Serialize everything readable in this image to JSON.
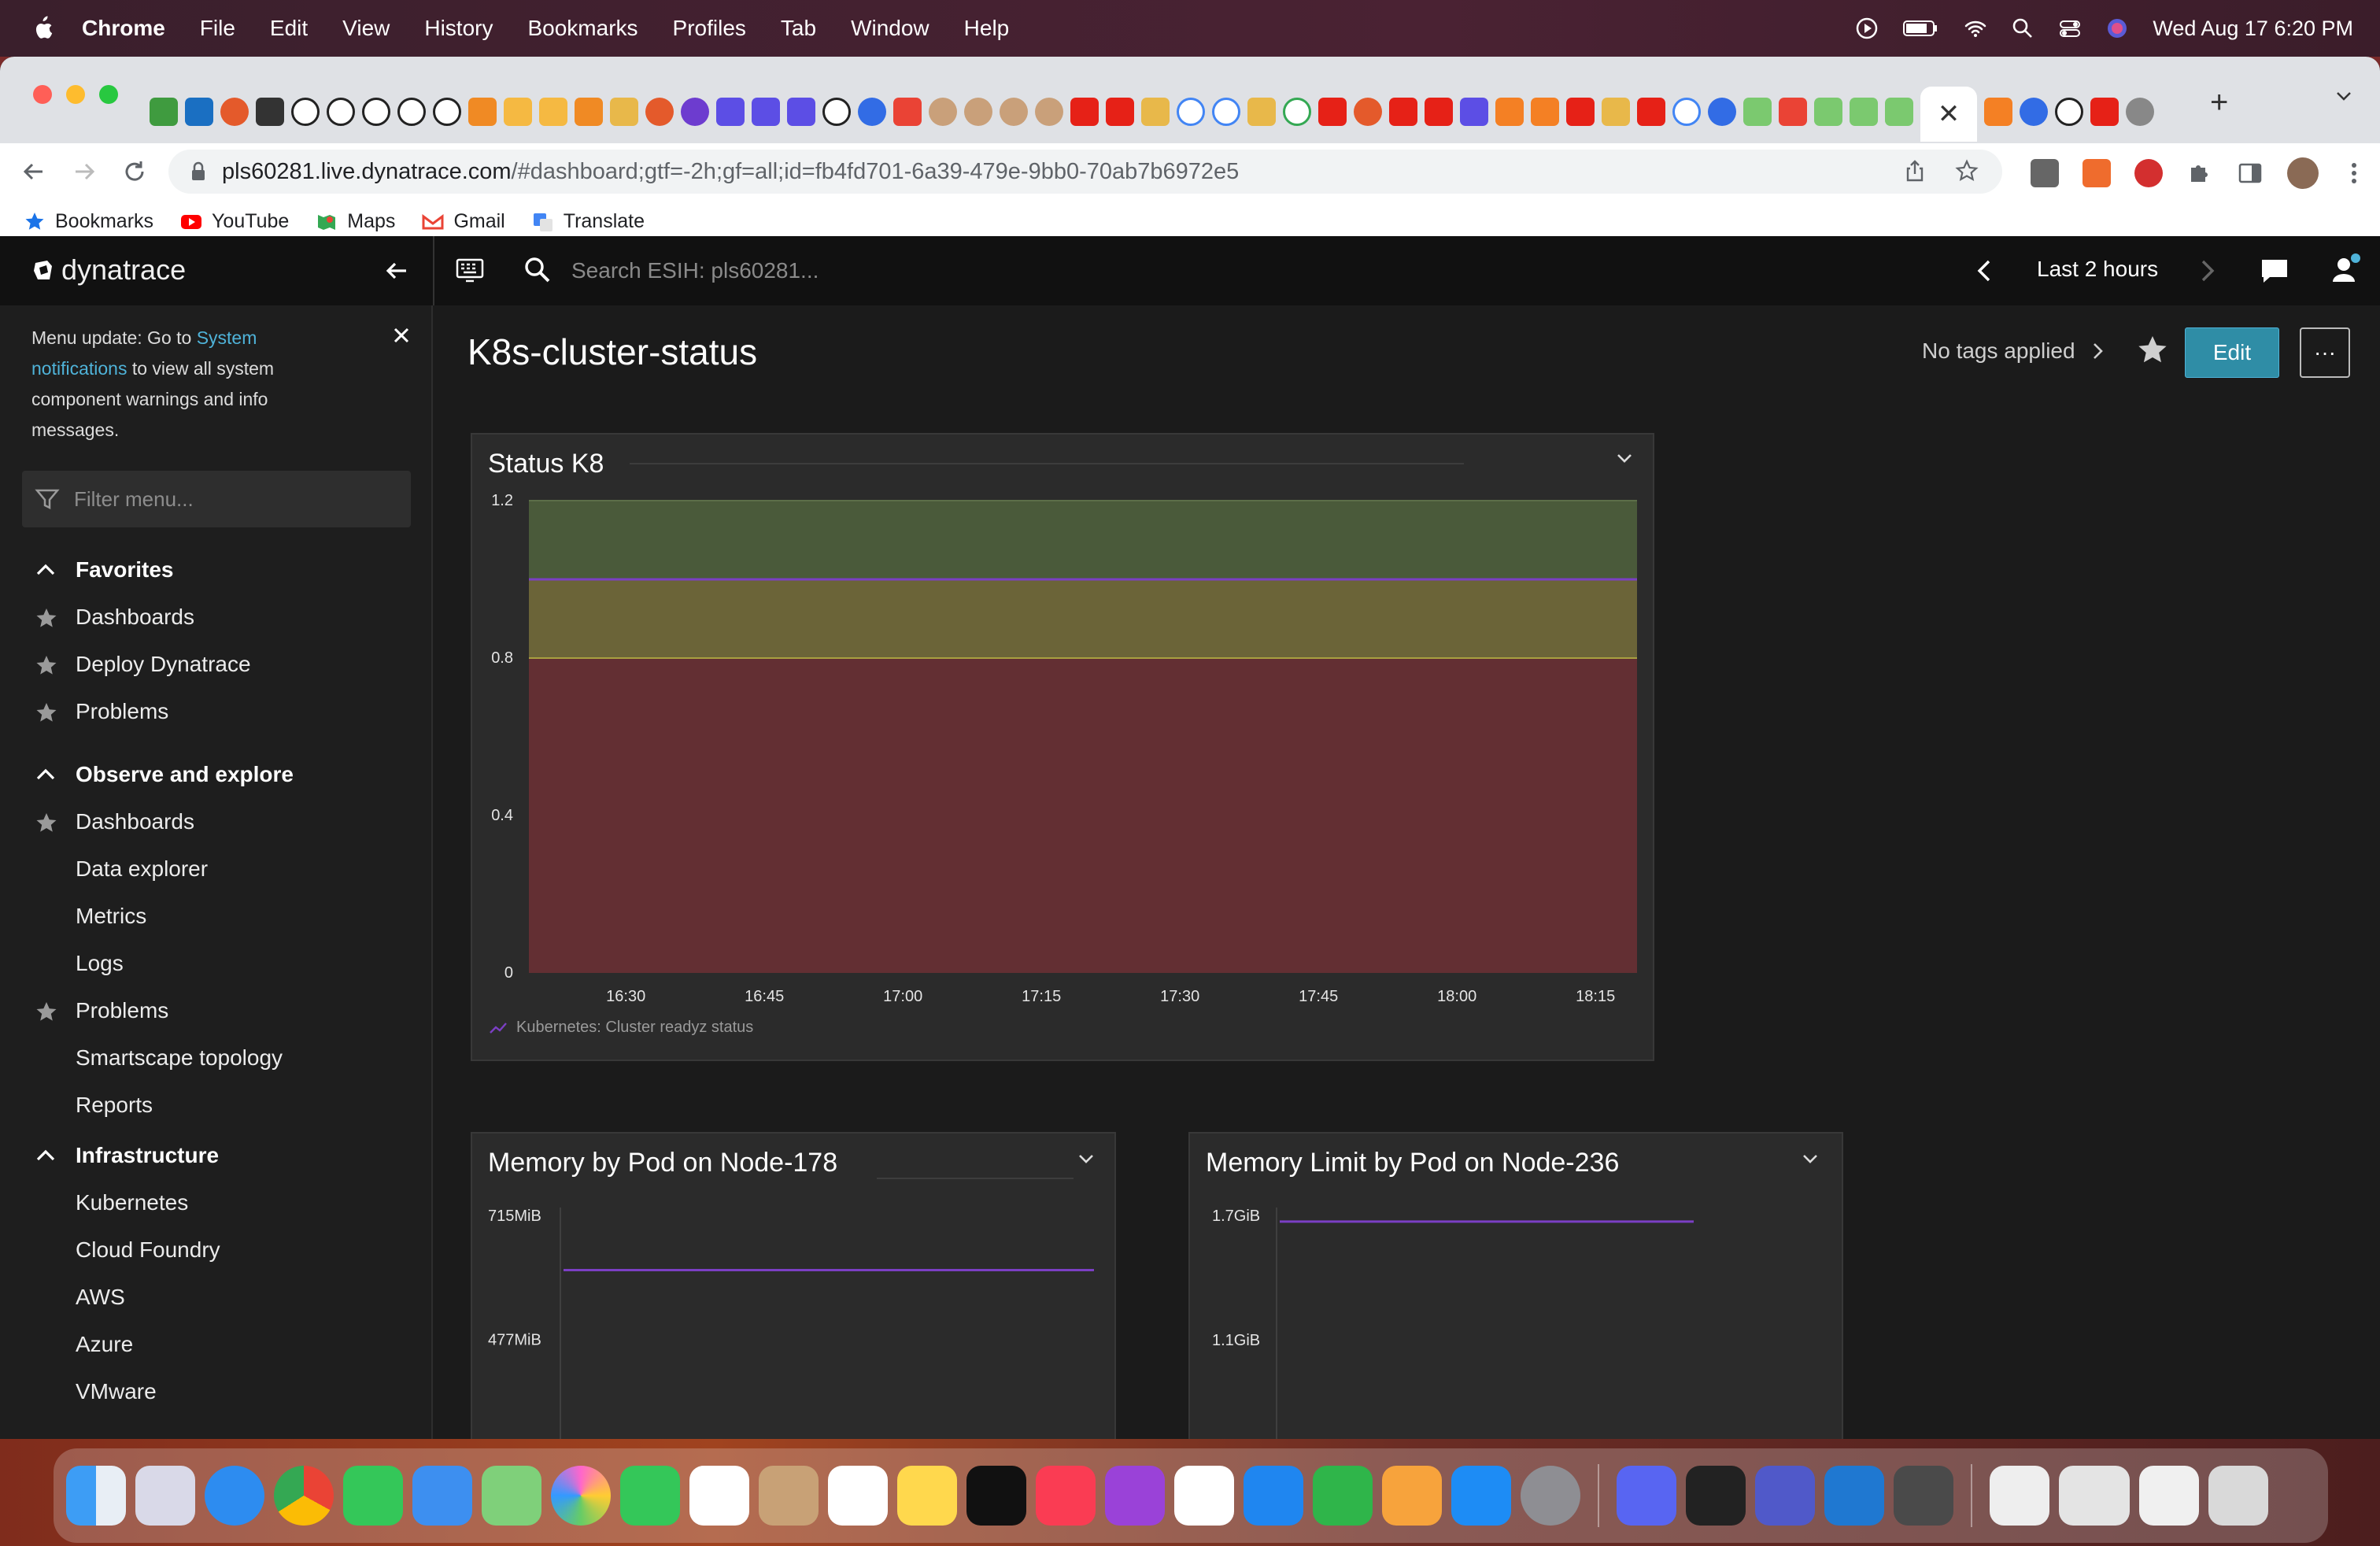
{
  "menubar": {
    "items": [
      "Chrome",
      "File",
      "Edit",
      "View",
      "History",
      "Bookmarks",
      "Profiles",
      "Tab",
      "Window",
      "Help"
    ],
    "datetime": "Wed Aug 17  6:20 PM"
  },
  "browser": {
    "url_host": "pls60281.live.dynatrace.com",
    "url_path": "/#dashboard;gtf=-2h;gf=all;id=fb4fd701-6a39-479e-9bb0-70ab7b6972e5",
    "bookmarks": [
      "Bookmarks",
      "YouTube",
      "Maps",
      "Gmail",
      "Translate"
    ]
  },
  "app": {
    "brand": "dynatrace",
    "search_placeholder": "Search ESIH: pls60281...",
    "timeframe": "Last 2 hours"
  },
  "sidebar": {
    "notice_pre": "Menu update: Go to ",
    "notice_link": "System notifications",
    "notice_post": " to view all system component warnings and info messages.",
    "filter_placeholder": "Filter menu...",
    "sections": [
      {
        "title": "Favorites",
        "items": [
          {
            "label": "Dashboards",
            "star": true
          },
          {
            "label": "Deploy Dynatrace",
            "star": true
          },
          {
            "label": "Problems",
            "star": true
          }
        ]
      },
      {
        "title": "Observe and explore",
        "items": [
          {
            "label": "Dashboards",
            "star": true
          },
          {
            "label": "Data explorer",
            "star": false
          },
          {
            "label": "Metrics",
            "star": false
          },
          {
            "label": "Logs",
            "star": false
          },
          {
            "label": "Problems",
            "star": true
          },
          {
            "label": "Smartscape topology",
            "star": false
          },
          {
            "label": "Reports",
            "star": false
          }
        ]
      },
      {
        "title": "Infrastructure",
        "items": [
          {
            "label": "Kubernetes",
            "star": false
          },
          {
            "label": "Cloud Foundry",
            "star": false
          },
          {
            "label": "AWS",
            "star": false
          },
          {
            "label": "Azure",
            "star": false
          },
          {
            "label": "VMware",
            "star": false
          }
        ]
      }
    ]
  },
  "dashboard": {
    "title": "K8s-cluster-status",
    "tags": "No tags applied",
    "edit_label": "Edit",
    "more_label": "···"
  },
  "colors": {
    "accent": "#2f8da6",
    "band_green": "#4a5a3a",
    "band_yellow": "#6b6438",
    "band_red": "#632f33",
    "series_purple": "#7b3fc4"
  },
  "chart_data": [
    {
      "type": "line",
      "title": "Status K8",
      "x": [
        "16:30",
        "16:45",
        "17:00",
        "17:15",
        "17:30",
        "17:45",
        "18:00",
        "18:15"
      ],
      "yticks": [
        "0",
        "0.4",
        "0.8",
        "1.2"
      ],
      "ylim": [
        0,
        1.2
      ],
      "thresholds": [
        {
          "from": 0,
          "to": 0.8,
          "color": "red"
        },
        {
          "from": 0.8,
          "to": 1.0,
          "color": "yellow"
        },
        {
          "from": 1.0,
          "to": 1.2,
          "color": "green"
        }
      ],
      "series": [
        {
          "name": "Kubernetes: Cluster readyz status",
          "values": [
            1,
            1,
            1,
            1,
            1,
            1,
            1,
            1
          ]
        }
      ]
    },
    {
      "type": "line",
      "title": "Memory by Pod on Node-178",
      "yticks": [
        "715MiB",
        "477MiB"
      ],
      "series": [
        {
          "values": [
            610,
            610
          ]
        }
      ],
      "ylim_mib": [
        238,
        715
      ]
    },
    {
      "type": "line",
      "title": "Memory Limit by Pod on Node-236",
      "yticks": [
        "1.7GiB",
        "1.1GiB"
      ],
      "series": [
        {
          "values": [
            1.67,
            1.67
          ]
        }
      ],
      "ylim_gib": [
        0.5,
        1.7
      ]
    }
  ]
}
